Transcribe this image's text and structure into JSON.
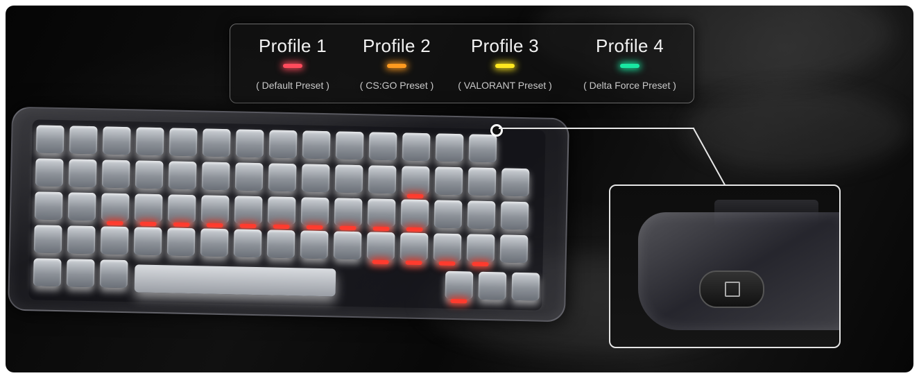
{
  "profiles": [
    {
      "title": "Profile 1",
      "subtitle": "( Default Preset )",
      "led_color": "#ff4b5c"
    },
    {
      "title": "Profile 2",
      "subtitle": "( CS:GO Preset )",
      "led_color": "#ff9a1f"
    },
    {
      "title": "Profile 3",
      "subtitle": "( VALORANT Preset )",
      "led_color": "#ffe81f"
    },
    {
      "title": "Profile 4",
      "subtitle": "( Delta Force Preset )",
      "led_color": "#19e8a2"
    }
  ],
  "colors": {
    "backlight_red": "#ff3b2e",
    "backlight_white": "#ffffff",
    "background": "#0b0b0b"
  }
}
